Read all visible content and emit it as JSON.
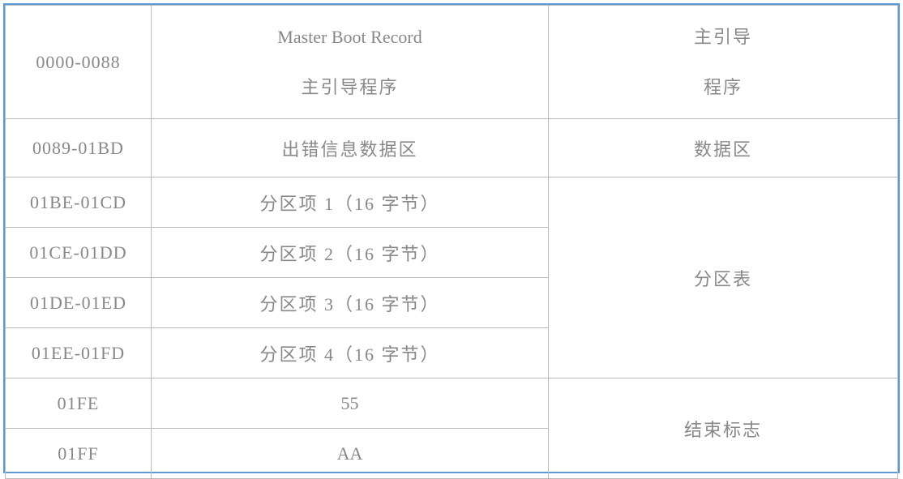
{
  "table": {
    "rows": [
      {
        "offset": "0000-0088",
        "content_line1": "Master Boot Record",
        "content_line2": "主引导程序",
        "category_line1": "主引导",
        "category_line2": "程序"
      },
      {
        "offset": "0089-01BD",
        "content": "出错信息数据区",
        "category": "数据区"
      },
      {
        "offset": "01BE-01CD",
        "content": "分区项 1（16 字节）"
      },
      {
        "offset": "01CE-01DD",
        "content": "分区项 2（16 字节）"
      },
      {
        "offset": "01DE-01ED",
        "content": "分区项 3（16 字节）"
      },
      {
        "offset": "01EE-01FD",
        "content": "分区项 4（16 字节）"
      },
      {
        "partition_category": "分区表"
      },
      {
        "offset": "01FE",
        "content": "55"
      },
      {
        "offset": "01FF",
        "content": "AA"
      },
      {
        "end_category": "结束标志"
      }
    ]
  }
}
